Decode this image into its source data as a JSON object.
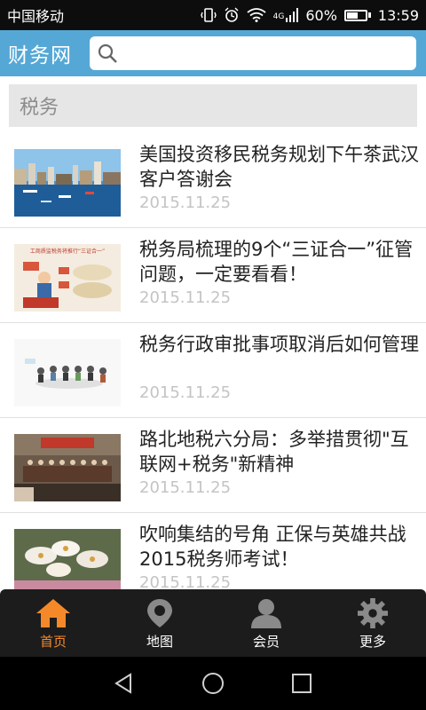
{
  "status": {
    "carrier": "中国移动",
    "network": "4G",
    "battery": "60%",
    "battery_level": 0.6,
    "time": "13:59"
  },
  "header": {
    "logo": "财务网",
    "search_placeholder": ""
  },
  "section": {
    "title": "税务"
  },
  "news": [
    {
      "title": "美国投资移民税务规划下午茶武汉客户答谢会",
      "date": "2015.11.25"
    },
    {
      "title": "税务局梳理的9个“三证合一”征管问题，一定要看看！",
      "date": "2015.11.25"
    },
    {
      "title": "税务行政审批事项取消后如何管理",
      "date": "2015.11.25"
    },
    {
      "title": "路北地税六分局：多举措贯彻\"互联网+税务\"新精神",
      "date": "2015.11.25"
    },
    {
      "title": "吹响集结的号角 正保与英雄共战2015税务师考试！",
      "date": "2015.11.25"
    }
  ],
  "thumb_captions": {
    "item2": "工商质监税务将推行“三证合一”"
  },
  "tabs": [
    {
      "label": "首页",
      "icon": "home-icon",
      "active": true
    },
    {
      "label": "地图",
      "icon": "map-pin-icon",
      "active": false
    },
    {
      "label": "会员",
      "icon": "user-icon",
      "active": false
    },
    {
      "label": "更多",
      "icon": "gear-icon",
      "active": false
    }
  ],
  "colors": {
    "header_bg": "#55a8d6",
    "active_tab": "#f5892a",
    "tab_bar_bg": "#1c1c1c",
    "date_text": "#c4c4c4"
  }
}
